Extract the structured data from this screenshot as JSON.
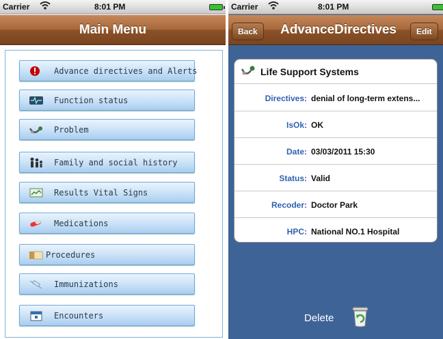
{
  "left_screen": {
    "status": {
      "carrier": "Carrier",
      "time": "8:01 PM"
    },
    "nav": {
      "title": "Main Menu"
    },
    "menu": [
      {
        "label": "Advance directives and Alerts",
        "icon": "alert-icon"
      },
      {
        "label": "Function status",
        "icon": "monitor-icon"
      },
      {
        "label": "Problem",
        "icon": "stethoscope-icon"
      },
      {
        "label": "Family and social history",
        "icon": "family-icon"
      },
      {
        "label": "Results Vital Signs",
        "icon": "chart-icon"
      },
      {
        "label": "Medications",
        "icon": "pills-icon"
      },
      {
        "label": "Procedures",
        "icon": "folder-icon"
      },
      {
        "label": "Immunizations",
        "icon": "syringe-icon"
      },
      {
        "label": "Encounters",
        "icon": "calendar-icon"
      }
    ]
  },
  "right_screen": {
    "status": {
      "carrier": "Carrier",
      "time": "8:01 PM"
    },
    "nav": {
      "back": "Back",
      "title": "AdvanceDirectives",
      "edit": "Edit"
    },
    "card": {
      "title": "Life Support Systems",
      "rows": [
        {
          "key": "Directives:",
          "value": "denial of long-term extens..."
        },
        {
          "key": "IsOk:",
          "value": "OK"
        },
        {
          "key": "Date:",
          "value": "03/03/2011 15:30"
        },
        {
          "key": "Status:",
          "value": "Valid"
        },
        {
          "key": "Recoder:",
          "value": "Doctor Park"
        },
        {
          "key": "HPC:",
          "value": "National NO.1 Hospital"
        }
      ]
    },
    "delete_label": "Delete"
  },
  "colors": {
    "nav_brown": "#8b5127",
    "menu_blue": "#c8e1f7",
    "detail_bg": "#3e6396",
    "key_blue": "#3060b0"
  }
}
